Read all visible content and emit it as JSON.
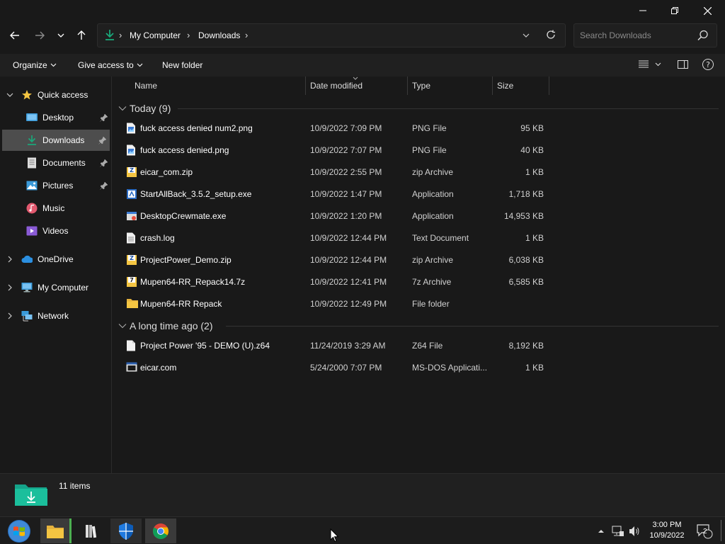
{
  "window": {
    "address_parts": [
      "My Computer",
      "Downloads"
    ],
    "search_placeholder": "Search Downloads"
  },
  "commands": {
    "organize": "Organize",
    "give_access": "Give access to",
    "new_folder": "New folder"
  },
  "sidebar": {
    "quick_access": "Quick access",
    "items": [
      {
        "label": "Desktop",
        "icon": "desktop-icon",
        "pinned": true
      },
      {
        "label": "Downloads",
        "icon": "download-icon",
        "pinned": true,
        "selected": true
      },
      {
        "label": "Documents",
        "icon": "documents-icon",
        "pinned": true
      },
      {
        "label": "Pictures",
        "icon": "pictures-icon",
        "pinned": true
      },
      {
        "label": "Music",
        "icon": "music-icon",
        "pinned": false
      },
      {
        "label": "Videos",
        "icon": "videos-icon",
        "pinned": false
      }
    ],
    "onedrive": "OneDrive",
    "my_computer": "My Computer",
    "network": "Network"
  },
  "columns": {
    "name": "Name",
    "date": "Date modified",
    "type": "Type",
    "size": "Size"
  },
  "groups": [
    {
      "title": "Today (9)",
      "files": [
        {
          "name": "fuck access denied num2.png",
          "date": "10/9/2022 7:09 PM",
          "type": "PNG File",
          "size": "95 KB",
          "icon": "image-file-icon"
        },
        {
          "name": "fuck access denied.png",
          "date": "10/9/2022 7:07 PM",
          "type": "PNG File",
          "size": "40 KB",
          "icon": "image-file-icon"
        },
        {
          "name": "eicar_com.zip",
          "date": "10/9/2022 2:55 PM",
          "type": "zip Archive",
          "size": "1 KB",
          "icon": "archive-icon"
        },
        {
          "name": "StartAllBack_3.5.2_setup.exe",
          "date": "10/9/2022 1:47 PM",
          "type": "Application",
          "size": "1,718 KB",
          "icon": "setup-exe-icon"
        },
        {
          "name": "DesktopCrewmate.exe",
          "date": "10/9/2022 1:20 PM",
          "type": "Application",
          "size": "14,953 KB",
          "icon": "app-exe-icon"
        },
        {
          "name": "crash.log",
          "date": "10/9/2022 12:44 PM",
          "type": "Text Document",
          "size": "1 KB",
          "icon": "text-file-icon"
        },
        {
          "name": "ProjectPower_Demo.zip",
          "date": "10/9/2022 12:44 PM",
          "type": "zip Archive",
          "size": "6,038 KB",
          "icon": "archive-icon"
        },
        {
          "name": "Mupen64-RR_Repack14.7z",
          "date": "10/9/2022 12:41 PM",
          "type": "7z Archive",
          "size": "6,585 KB",
          "icon": "archive-7z-icon"
        },
        {
          "name": "Mupen64-RR Repack",
          "date": "10/9/2022 12:49 PM",
          "type": "File folder",
          "size": "",
          "icon": "folder-icon"
        }
      ]
    },
    {
      "title": "A long time ago (2)",
      "files": [
        {
          "name": "Project Power '95 - DEMO (U).z64",
          "date": "11/24/2019 3:29 AM",
          "type": "Z64 File",
          "size": "8,192 KB",
          "icon": "generic-file-icon"
        },
        {
          "name": "eicar.com",
          "date": "5/24/2000 7:07 PM",
          "type": "MS-DOS Applicati...",
          "size": "1 KB",
          "icon": "dos-app-icon"
        }
      ]
    }
  ],
  "status": {
    "items": "11 items"
  },
  "taskbar": {
    "time": "3:00 PM",
    "date": "10/9/2022",
    "notifications": "2"
  },
  "colors": {
    "window_bg": "#191919",
    "selected_bg": "#4d4d4d",
    "accent_green": "#1aa87a",
    "folder_yellow": "#f4c542"
  }
}
